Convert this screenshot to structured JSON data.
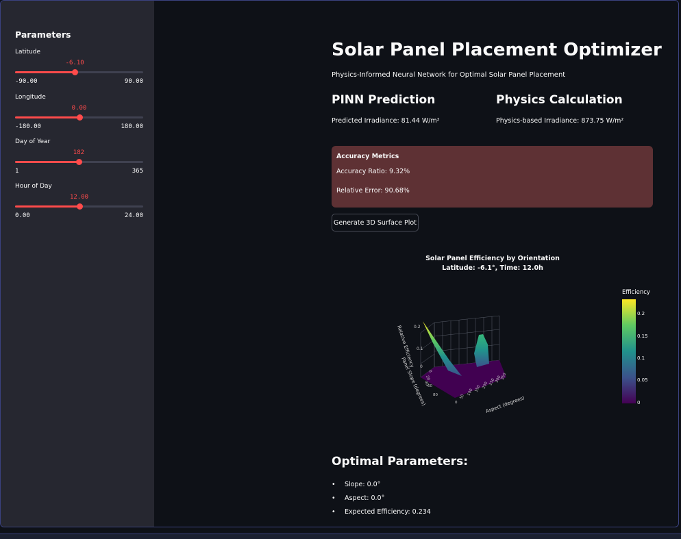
{
  "sidebar": {
    "title": "Parameters",
    "sliders": [
      {
        "label": "Latitude",
        "value": "-6.10",
        "min": "-90.00",
        "max": "90.00",
        "fraction": 0.466
      },
      {
        "label": "Longitude",
        "value": "0.00",
        "min": "-180.00",
        "max": "180.00",
        "fraction": 0.5
      },
      {
        "label": "Day of Year",
        "value": "182",
        "min": "1",
        "max": "365",
        "fraction": 0.497
      },
      {
        "label": "Hour of Day",
        "value": "12.00",
        "min": "0.00",
        "max": "24.00",
        "fraction": 0.5
      }
    ]
  },
  "main": {
    "title": "Solar Panel Placement Optimizer",
    "subtitle": "Physics-Informed Neural Network for Optimal Solar Panel Placement",
    "pinn": {
      "heading": "PINN Prediction",
      "text": "Predicted Irradiance: 81.44 W/m²"
    },
    "physics": {
      "heading": "Physics Calculation",
      "text": "Physics-based Irradiance: 873.75 W/m²"
    },
    "metrics": {
      "title": "Accuracy Metrics",
      "ratio": "Accuracy Ratio: 9.32%",
      "error": "Relative Error: 90.68%",
      "background": "#5e3134"
    },
    "button_label": "Generate 3D Surface Plot",
    "optimal": {
      "heading": "Optimal Parameters:",
      "items": [
        "Slope: 0.0°",
        "Aspect: 0.0°",
        "Expected Efficiency: 0.234"
      ]
    }
  },
  "colors": {
    "accent": "#ff4b4b",
    "background": "#0e1117",
    "sidebar": "#262730"
  },
  "chart_data": {
    "type": "surface",
    "title_line1": "Solar Panel Efficiency by Orientation",
    "title_line2": "Latitude: -6.1°, Time: 12.0h",
    "zlabel": "Relative Efficiency",
    "ylabel": "Panel Slope (degrees)",
    "xlabel": "Aspect (degrees)",
    "colorbar_title": "Efficiency",
    "colorbar_ticks": [
      "0.2",
      "0.15",
      "0.1",
      "0.05",
      "0"
    ],
    "colorscale": "viridis",
    "zlim": [
      0,
      0.234
    ],
    "z_ticks": [
      "0.2",
      "0.1",
      "0"
    ],
    "slope_ticks": [
      "0",
      "20",
      "40",
      "60",
      "80"
    ],
    "aspect_ticks": [
      "0",
      "50",
      "100",
      "150",
      "200",
      "250",
      "300",
      "350"
    ],
    "peaks": [
      {
        "label": "slope 0, aspect 0",
        "value": 0.234
      },
      {
        "label": "slope 0, aspect 350",
        "value": 0.16
      }
    ],
    "base_value": 0
  }
}
